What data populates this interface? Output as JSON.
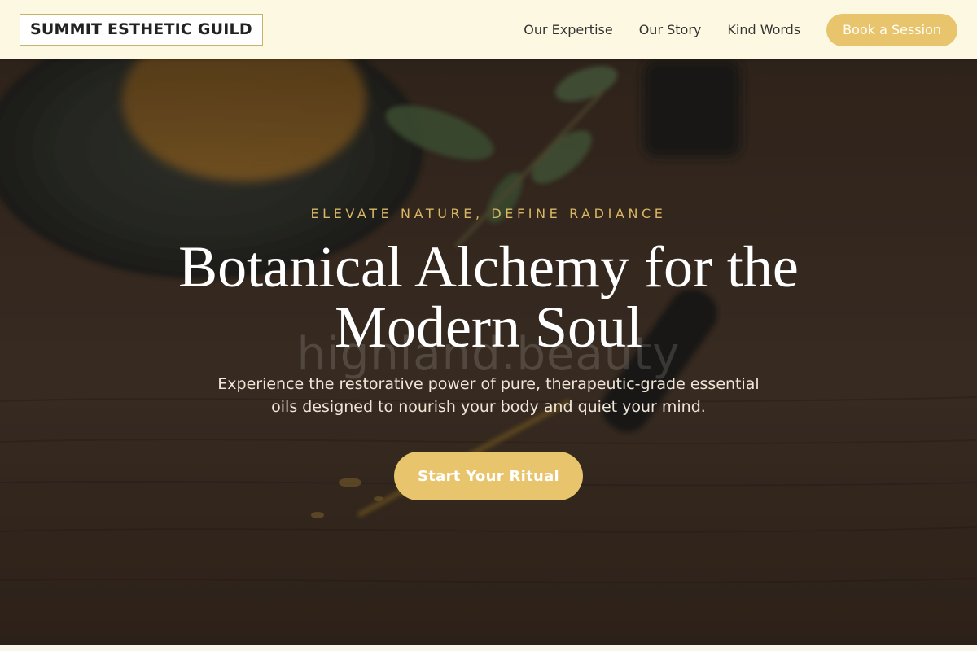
{
  "header": {
    "logo": "SUMMIT ESTHETIC GUILD",
    "nav": [
      {
        "label": "Our Expertise"
      },
      {
        "label": "Our Story"
      },
      {
        "label": "Kind Words"
      }
    ],
    "cta_label": "Book a Session"
  },
  "hero": {
    "eyebrow": "ELEVATE NATURE, DEFINE RADIANCE",
    "headline": "Botanical Alchemy for the Modern Soul",
    "watermark": "highland.beauty",
    "subtext": "Experience the restorative power of pure, therapeutic-grade essential oils designed to nourish your body and quiet your mind.",
    "cta_label": "Start Your Ritual"
  },
  "colors": {
    "accent": "#e8c46c",
    "header_bg": "#fdf8e2",
    "eyebrow": "#d9b764"
  }
}
